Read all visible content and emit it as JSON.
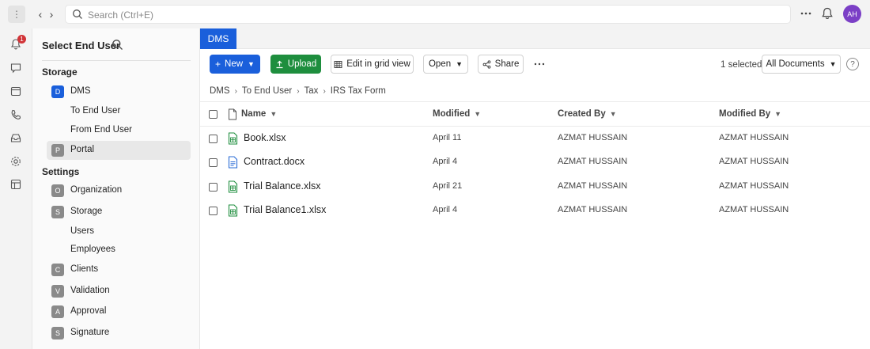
{
  "topbar": {
    "search_placeholder": "Search (Ctrl+E)",
    "avatar_initials": "AH"
  },
  "rail": {
    "notification_count": "1"
  },
  "sidebar": {
    "title": "Select End User",
    "storage_header": "Storage",
    "storage_items": [
      {
        "tile": "D",
        "label": "DMS"
      },
      {
        "tile": "",
        "label": "To End User"
      },
      {
        "tile": "",
        "label": "From End User"
      },
      {
        "tile": "P",
        "label": "Portal"
      }
    ],
    "settings_header": "Settings",
    "settings_items": [
      {
        "tile": "O",
        "label": "Organization"
      },
      {
        "tile": "S",
        "label": "Storage"
      },
      {
        "tile": "",
        "label": "Users"
      },
      {
        "tile": "",
        "label": "Employees"
      },
      {
        "tile": "C",
        "label": "Clients"
      },
      {
        "tile": "V",
        "label": "Validation"
      },
      {
        "tile": "A",
        "label": "Approval"
      },
      {
        "tile": "S",
        "label": "Signature"
      }
    ]
  },
  "tabs": {
    "active": "DMS"
  },
  "toolbar": {
    "new_label": "New",
    "upload_label": "Upload",
    "grid_label": "Edit in grid view",
    "open_label": "Open",
    "share_label": "Share",
    "selected_text": "1 selected",
    "view_label": "All Documents"
  },
  "breadcrumb": [
    "DMS",
    "To End User",
    "Tax",
    "IRS Tax Form"
  ],
  "table": {
    "columns": {
      "name": "Name",
      "modified": "Modified",
      "created_by": "Created By",
      "modified_by": "Modified By"
    },
    "rows": [
      {
        "name": "Book.xlsx",
        "type": "xlsx",
        "modified": "April 11",
        "created_by": "AZMAT HUSSAIN",
        "modified_by": "AZMAT HUSSAIN"
      },
      {
        "name": "Contract.docx",
        "type": "docx",
        "modified": "April 4",
        "created_by": "AZMAT HUSSAIN",
        "modified_by": "AZMAT HUSSAIN"
      },
      {
        "name": "Trial Balance.xlsx",
        "type": "xlsx",
        "modified": "April 21",
        "created_by": "AZMAT HUSSAIN",
        "modified_by": "AZMAT HUSSAIN"
      },
      {
        "name": "Trial Balance1.xlsx",
        "type": "xlsx",
        "modified": "April 4",
        "created_by": "AZMAT HUSSAIN",
        "modified_by": "AZMAT HUSSAIN"
      }
    ]
  },
  "colors": {
    "accent": "#1a5fdb",
    "upload": "#1e8e3e",
    "avatar": "#7b3fc6",
    "badge": "#d13438",
    "xlsx": "#1e8e3e",
    "docx": "#2b6cd6"
  }
}
